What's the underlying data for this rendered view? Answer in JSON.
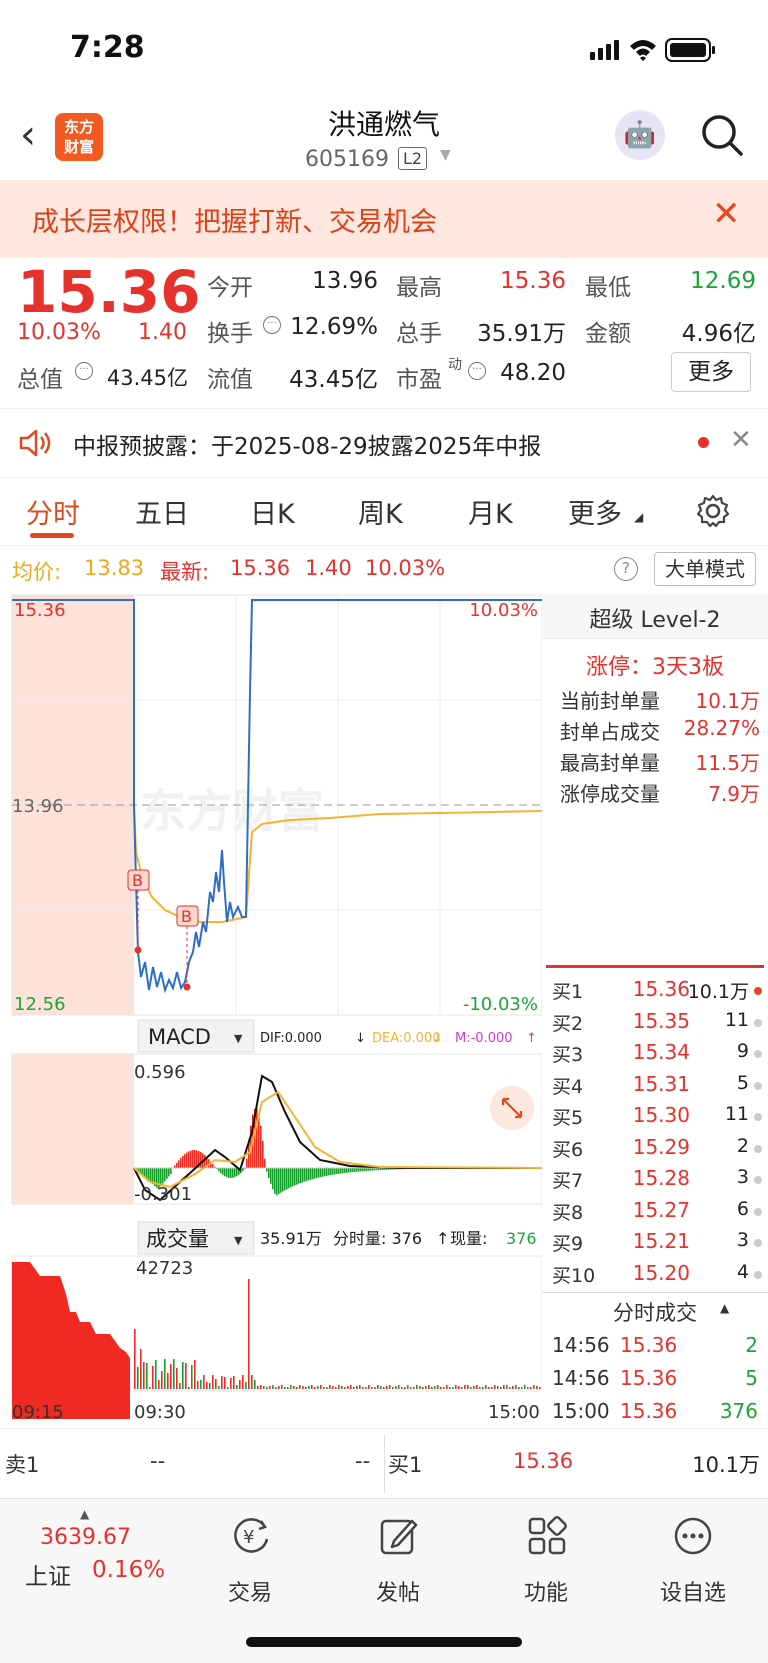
{
  "status": {
    "time": "7:28"
  },
  "header": {
    "name": "洪通燃气",
    "code": "605169",
    "level_badge": "L2",
    "logo_text": "东方财富"
  },
  "banner": {
    "text": "成长层权限！把握打新、交易机会"
  },
  "quote": {
    "price": "15.36",
    "pct": "10.03%",
    "change": "1.40",
    "items": [
      {
        "label": "今开",
        "value": "13.96",
        "color": "#222"
      },
      {
        "label": "最高",
        "value": "15.36",
        "color": "#e5322d"
      },
      {
        "label": "最低",
        "value": "12.69",
        "color": "#1ea53a"
      },
      {
        "label": "换手",
        "value": "12.69%",
        "color": "#222"
      },
      {
        "label": "总手",
        "value": "35.91万",
        "color": "#222"
      },
      {
        "label": "金额",
        "value": "4.96亿",
        "color": "#222"
      },
      {
        "label": "总值",
        "value": "43.45亿",
        "color": "#222"
      },
      {
        "label": "流值",
        "value": "43.45亿",
        "color": "#222"
      },
      {
        "label": "市盈",
        "value": "48.20",
        "color": "#222"
      }
    ],
    "pe_tag": "动",
    "more_label": "更多"
  },
  "notice": {
    "text": "中报预披露：于2025-08-29披露2025年中报"
  },
  "tabs": [
    "分时",
    "五日",
    "日K",
    "周K",
    "月K",
    "更多"
  ],
  "info": {
    "avg_label": "均价:",
    "avg": "13.83",
    "last_label": "最新:",
    "last": "15.36",
    "chg": "1.40",
    "pct": "10.03%",
    "mode_label": "大单模式"
  },
  "chart_data": {
    "type": "line",
    "price_axis": {
      "top": "15.36",
      "mid": "13.96",
      "bottom": "12.56",
      "top_pct": "10.03%",
      "bottom_pct": "-10.03%",
      "ylim": [
        12.56,
        15.36
      ]
    },
    "time_labels": [
      "09:15",
      "09:30",
      "15:00"
    ],
    "series": [
      {
        "name": "price",
        "color": "#2f6fc0"
      },
      {
        "name": "avg",
        "color": "#f5b330"
      }
    ],
    "markers": [
      "B",
      "B"
    ],
    "watermark": "东方财富",
    "macd": {
      "label": "MACD",
      "dif": "DIF:0.000",
      "dea": "DEA:0.000",
      "m": "M:-0.000",
      "max": "0.596",
      "min": "-0.301"
    },
    "volume": {
      "label": "成交量",
      "total": "35.91万",
      "fsl": "分时量: 376",
      "now_label": "现量:",
      "now": "376",
      "max": "42723"
    }
  },
  "side": {
    "title": "超级 Level-2",
    "limit": "涨停：3天3板",
    "rows": [
      {
        "label": "当前封单量",
        "value": "10.1万"
      },
      {
        "label": "封单占成交",
        "value": "28.27%"
      },
      {
        "label": "最高封单量",
        "value": "11.5万"
      },
      {
        "label": "涨停成交量",
        "value": "7.9万"
      }
    ],
    "bids": [
      {
        "label": "买1",
        "price": "15.36",
        "vol": "10.1万"
      },
      {
        "label": "买2",
        "price": "15.35",
        "vol": "11"
      },
      {
        "label": "买3",
        "price": "15.34",
        "vol": "9"
      },
      {
        "label": "买4",
        "price": "15.31",
        "vol": "5"
      },
      {
        "label": "买5",
        "price": "15.30",
        "vol": "11"
      },
      {
        "label": "买6",
        "price": "15.29",
        "vol": "2"
      },
      {
        "label": "买7",
        "price": "15.28",
        "vol": "3"
      },
      {
        "label": "买8",
        "price": "15.27",
        "vol": "6"
      },
      {
        "label": "买9",
        "price": "15.21",
        "vol": "3"
      },
      {
        "label": "买10",
        "price": "15.20",
        "vol": "4"
      }
    ],
    "trades_title": "分时成交",
    "trades": [
      {
        "time": "14:56",
        "price": "15.36",
        "vol": "2"
      },
      {
        "time": "14:56",
        "price": "15.36",
        "vol": "5"
      },
      {
        "time": "15:00",
        "price": "15.36",
        "vol": "376"
      }
    ]
  },
  "tape": {
    "sell_label": "卖1",
    "sell_price": "--",
    "sell_vol": "--",
    "buy_label": "买1",
    "buy_price": "15.36",
    "buy_vol": "10.1万"
  },
  "tabbar": {
    "index_value": "3639.67",
    "index_name": "上证",
    "index_pct": "0.16%",
    "items": [
      "交易",
      "发帖",
      "功能",
      "设自选"
    ]
  }
}
